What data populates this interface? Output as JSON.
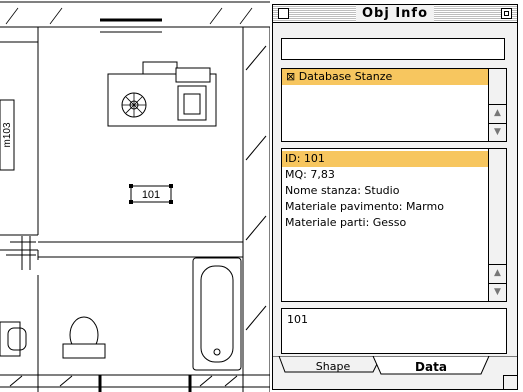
{
  "plan": {
    "room_tag": "101",
    "wall_label": "m103"
  },
  "palette": {
    "title": "Obj Info",
    "search_value": "",
    "list_items": [
      "⊠ Database Stanze"
    ],
    "info_lines": [
      "ID: 101",
      "MQ: 7,83",
      "Nome stanza: Studio",
      "Materiale pavimento: Marmo",
      "Materiale parti: Gesso"
    ],
    "value_field": "101",
    "tabs": [
      "Shape",
      "Data"
    ],
    "active_tab": "Data"
  },
  "colors": {
    "selection": "#f7c65f"
  }
}
